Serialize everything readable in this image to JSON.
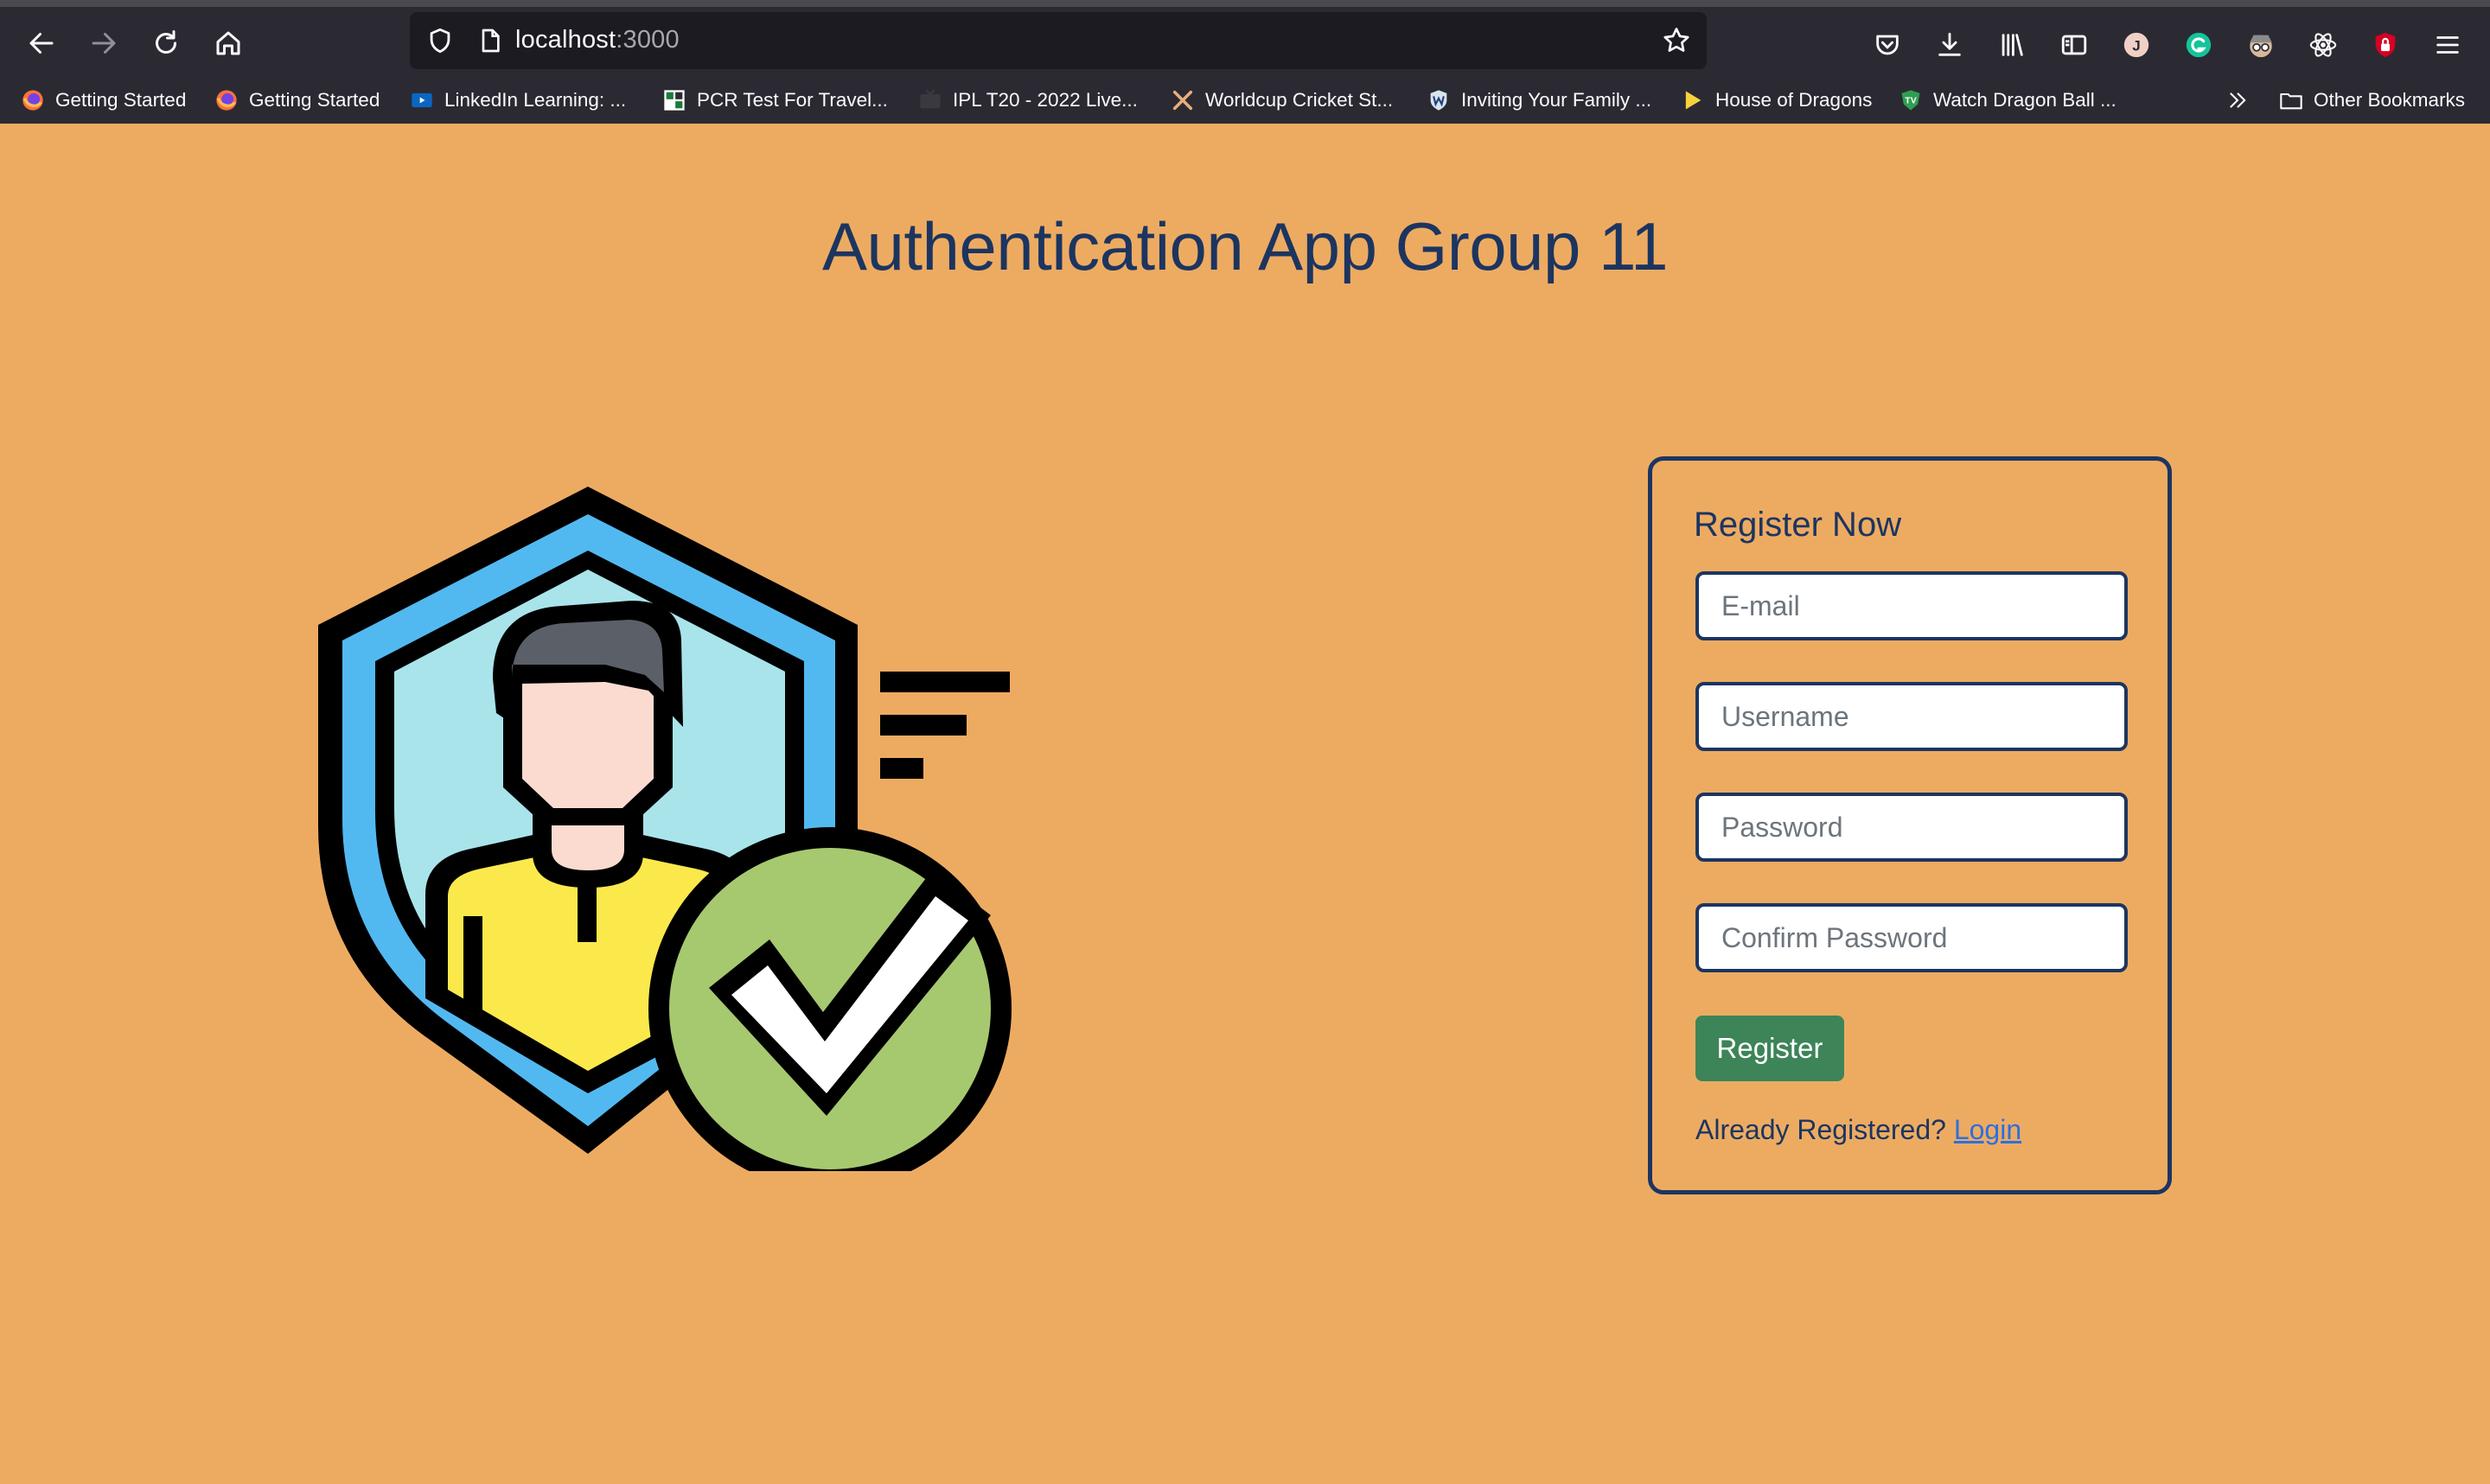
{
  "browser": {
    "url_host": "localhost",
    "url_port": ":3000",
    "bookmarks": [
      {
        "label": "Getting Started",
        "icon": "firefox-icon"
      },
      {
        "label": "Getting Started",
        "icon": "firefox-icon"
      },
      {
        "label": "LinkedIn Learning: ...",
        "icon": "linkedin-learning-icon"
      },
      {
        "label": "PCR Test For Travel...",
        "icon": "pcr-site-icon"
      },
      {
        "label": "IPL T20 - 2022 Live...",
        "icon": "tv-icon"
      },
      {
        "label": "Worldcup Cricket St...",
        "icon": "crossed-bats-icon"
      },
      {
        "label": "Inviting Your Family ...",
        "icon": "w-shield-icon"
      },
      {
        "label": "House of Dragons",
        "icon": "play-icon"
      },
      {
        "label": "Watch Dragon Ball ...",
        "icon": "tv-shield-icon"
      }
    ],
    "other_bookmarks": "Other Bookmarks",
    "profile_initial": "J"
  },
  "page": {
    "title": "Authentication App Group 11"
  },
  "register": {
    "heading": "Register Now",
    "email_placeholder": "E-mail",
    "username_placeholder": "Username",
    "password_placeholder": "Password",
    "confirm_placeholder": "Confirm Password",
    "button_label": "Register",
    "already_text": "Already Registered?",
    "login_link": "Login"
  },
  "colors": {
    "page_background": "#edab62",
    "heading": "#1c3560",
    "register_button": "#3d8458",
    "link": "#2c6fe0"
  }
}
